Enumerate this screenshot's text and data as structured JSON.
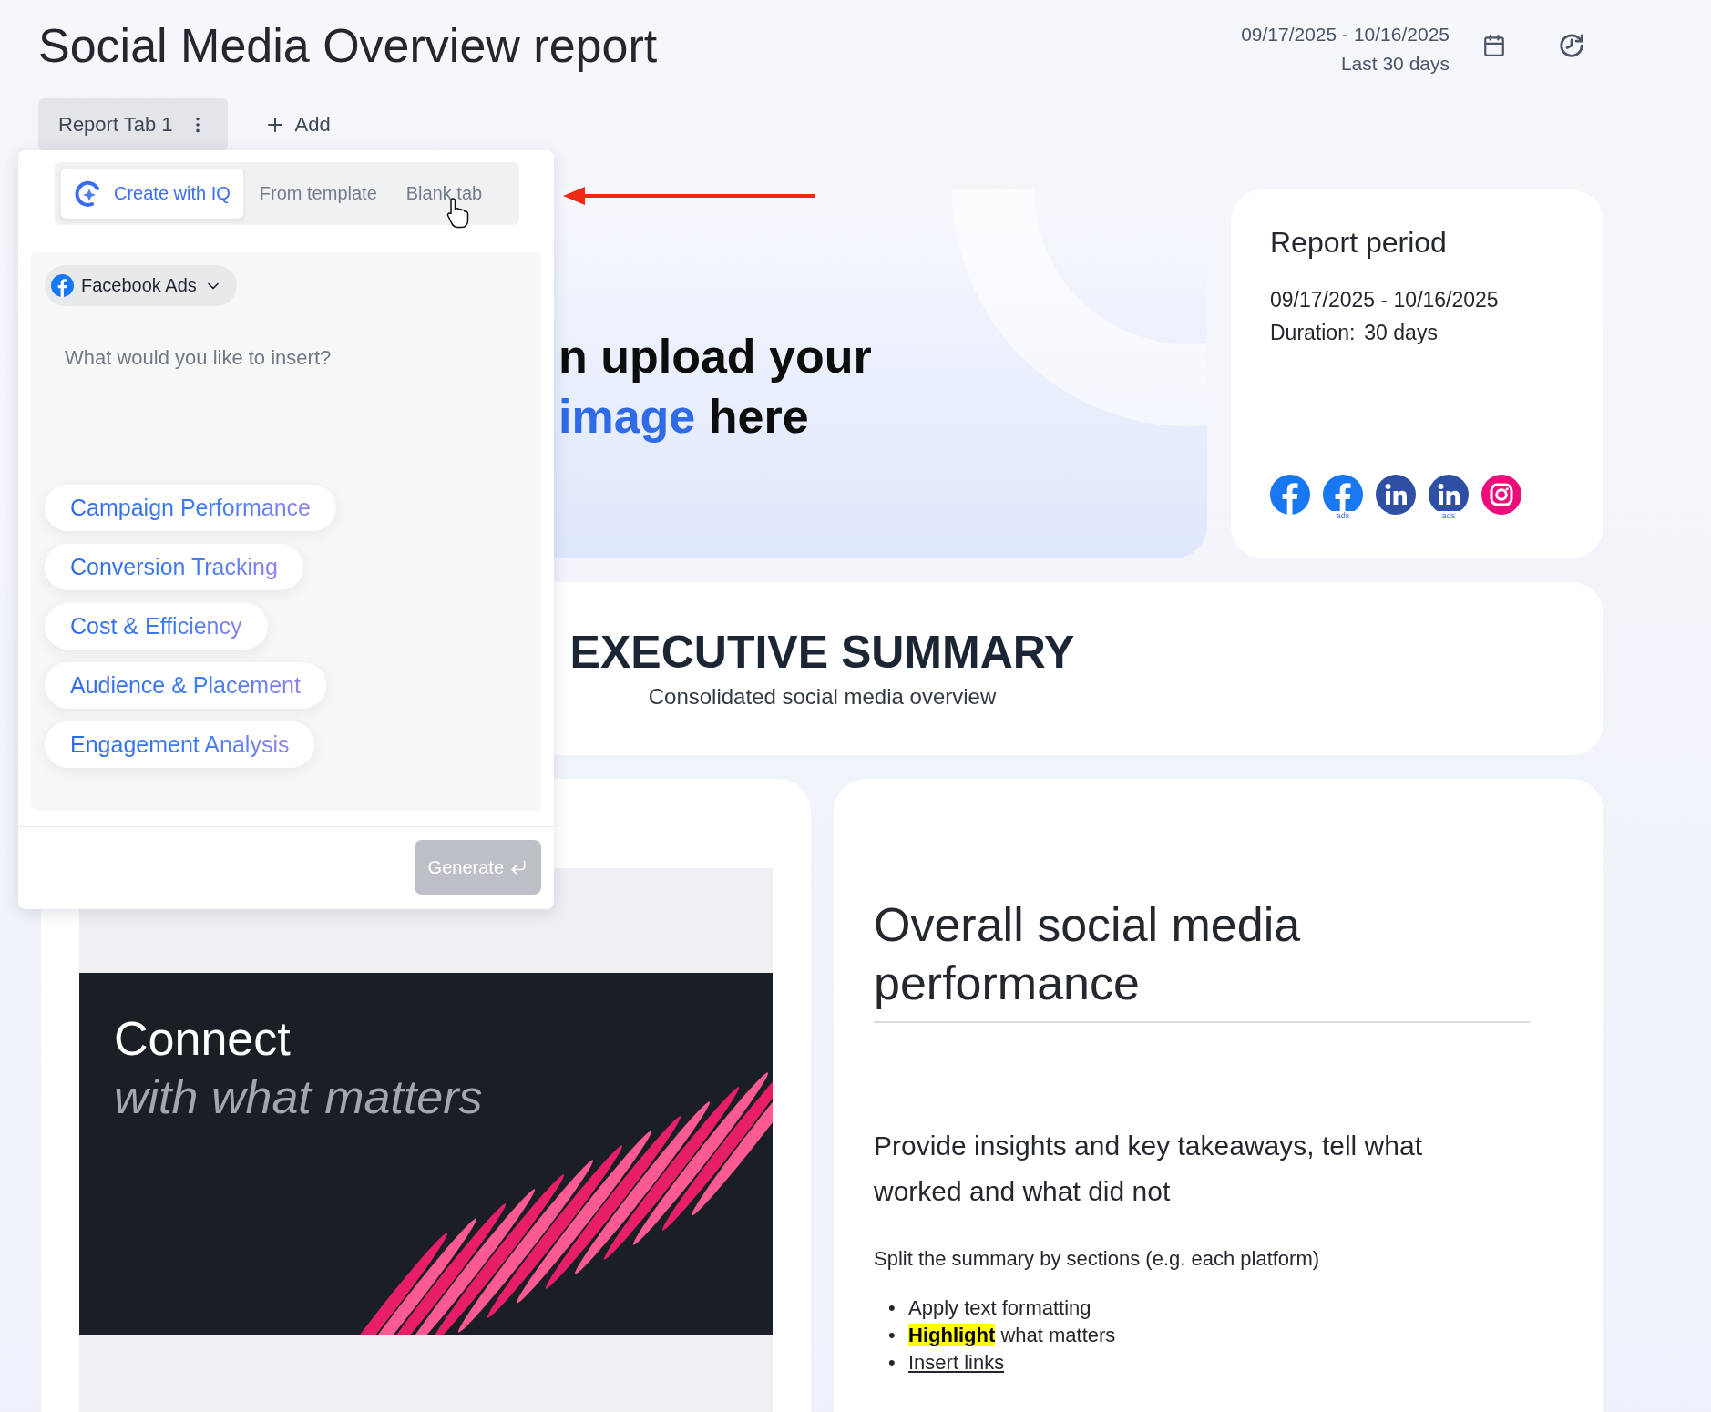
{
  "title": "Social Media Overview report",
  "date_range": {
    "range": "09/17/2025 - 10/16/2025",
    "preset": "Last 30 days"
  },
  "report_tabs": [
    {
      "label": "Report Tab 1",
      "selected": true
    }
  ],
  "add_tab": {
    "label": "Add"
  },
  "popup": {
    "modes": [
      {
        "label": "Create with IQ",
        "selected": true
      },
      {
        "label": "From template",
        "selected": false
      },
      {
        "label": "Blank tab",
        "selected": false
      }
    ],
    "source": {
      "label": "Facebook Ads"
    },
    "prompt": {
      "placeholder": "What would you like to insert?"
    },
    "suggestions": [
      "Campaign Performance",
      "Conversion Tracking",
      "Cost & Efficiency",
      "Audience & Placement",
      "Engagement Analysis"
    ],
    "generate": {
      "label": "Generate",
      "disabled": true
    }
  },
  "hero": {
    "line_1": "n upload your",
    "accent": "image",
    "line_2_rest": "here"
  },
  "report_period": {
    "title": "Report period",
    "range": "09/17/2025 - 10/16/2025",
    "duration_label": "Duration:",
    "duration": "30 days",
    "platforms": [
      {
        "kind": "facebook"
      },
      {
        "kind": "facebook",
        "badge": "ads"
      },
      {
        "kind": "linkedin"
      },
      {
        "kind": "linkedin",
        "badge": "ads"
      },
      {
        "kind": "instagram"
      }
    ]
  },
  "executive_summary": {
    "title": "EXECUTIVE SUMMARY",
    "subtitle": "Consolidated social media overview"
  },
  "banner": {
    "kind": "picture",
    "headline": "Connect",
    "tagline": "with what matters"
  },
  "overview": {
    "title": "Overall social media performance",
    "lead": "Provide insights and key takeaways, tell what worked and what did not",
    "note": "Split the summary by sections (e.g. each platform)",
    "bullets": [
      {
        "kind": "text",
        "marker": "•",
        "text": "Apply text formatting"
      },
      {
        "kind": "highlight",
        "marker": "•",
        "text": "**Highlight** what matters"
      },
      {
        "kind": "link",
        "marker": "•",
        "text": "Insert links"
      }
    ]
  }
}
